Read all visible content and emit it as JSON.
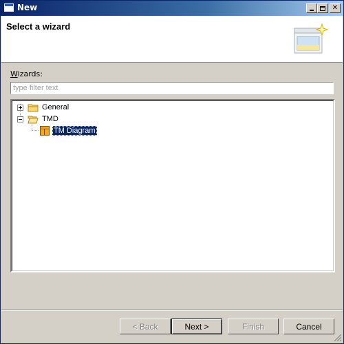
{
  "window": {
    "title": "New"
  },
  "header": {
    "title": "Select a wizard"
  },
  "wizards": {
    "label_mnemonic": "W",
    "label_rest": "izards:",
    "filter_placeholder": "type filter text",
    "filter_value": ""
  },
  "tree": {
    "nodes": [
      {
        "label": "General",
        "expanded": false,
        "icon": "folder-closed-icon"
      },
      {
        "label": "TMD",
        "expanded": true,
        "icon": "folder-open-icon",
        "children": [
          {
            "label": "TM Diagram",
            "icon": "diagram-icon",
            "selected": true
          }
        ]
      }
    ]
  },
  "buttons": {
    "back": "< Back",
    "next": "Next >",
    "finish": "Finish",
    "cancel": "Cancel"
  },
  "colors": {
    "titlebar_start": "#0a246a",
    "titlebar_end": "#a6caf0",
    "selection": "#0a246a",
    "face": "#d4d0c8"
  }
}
